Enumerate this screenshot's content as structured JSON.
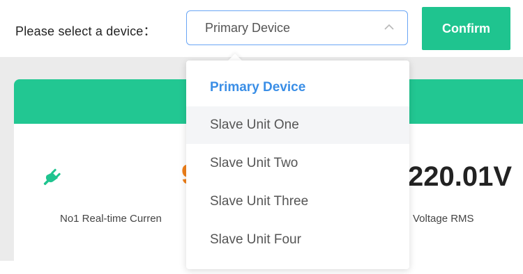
{
  "device_selector": {
    "label": "Please select a device：",
    "selected_value": "Primary Device",
    "confirm_label": "Confirm",
    "options": [
      "Primary Device",
      "Slave Unit One",
      "Slave Unit Two",
      "Slave Unit Three",
      "Slave Unit Four"
    ]
  },
  "card": {
    "metric_left_value": "9",
    "metric_left_label": "No1 Real-time Curren",
    "metric_right_value": "220.01V",
    "metric_right_label": "Voltage RMS"
  },
  "colors": {
    "accent": "#1fc48f",
    "card_header": "#22c792",
    "selected_option": "#3a8ee6",
    "current_value": "#f0801a"
  },
  "icons": {
    "plug": "plug-icon",
    "chevron": "chevron-up-icon"
  }
}
